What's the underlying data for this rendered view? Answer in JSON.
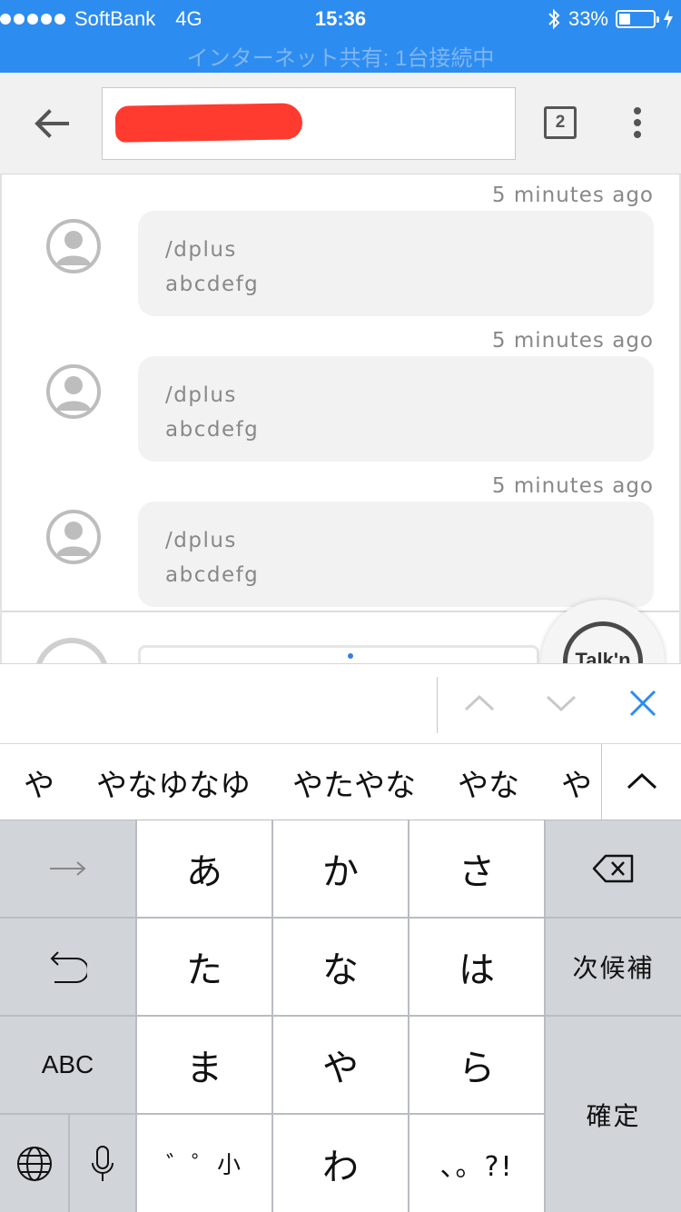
{
  "status_bar": {
    "carrier": "SoftBank",
    "network": "4G",
    "time": "15:36",
    "battery_percent": "33%",
    "battery_level": 0.33,
    "hotspot_text": "インターネット共有: 1台接続中",
    "background_color": "#2d8cf0"
  },
  "toolbar": {
    "tab_count": "2",
    "url_redacted": true
  },
  "messages": [
    {
      "time": "5 minutes ago",
      "line1": "/dplus",
      "line2": "abcdefg"
    },
    {
      "time": "5 minutes ago",
      "line1": "/dplus",
      "line2": "abcdefg"
    },
    {
      "time": "5 minutes ago",
      "line1": "/dplus",
      "line2": "abcdefg"
    }
  ],
  "talk_button": {
    "label": "Talk'n"
  },
  "candidates": [
    "や",
    "やなゆなゆ",
    "やたやな",
    "やな",
    "や"
  ],
  "keyboard": {
    "row1": [
      "あ",
      "か",
      "さ"
    ],
    "row2": [
      "た",
      "な",
      "は"
    ],
    "row3": [
      "ま",
      "や",
      "ら"
    ],
    "row4": [
      "゛゜小",
      "わ",
      "、。?!"
    ],
    "next_candidate": "次候補",
    "abc": "ABC",
    "confirm": "確定"
  }
}
